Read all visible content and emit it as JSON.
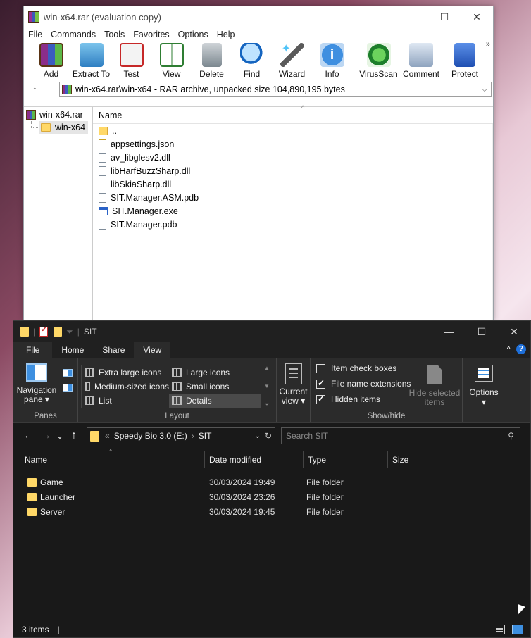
{
  "winrar": {
    "title": "win-x64.rar (evaluation copy)",
    "window_controls": {
      "minimize": "—",
      "maximize": "☐",
      "close": "✕"
    },
    "menu": [
      "File",
      "Commands",
      "Tools",
      "Favorites",
      "Options",
      "Help"
    ],
    "toolbar": [
      {
        "label": "Add",
        "icon": "add-archive-icon"
      },
      {
        "label": "Extract To",
        "icon": "extract-icon"
      },
      {
        "label": "Test",
        "icon": "test-icon"
      },
      {
        "label": "View",
        "icon": "view-book-icon"
      },
      {
        "label": "Delete",
        "icon": "trash-icon"
      },
      {
        "label": "Find",
        "icon": "magnifier-icon"
      },
      {
        "label": "Wizard",
        "icon": "magic-wand-icon"
      },
      {
        "label": "Info",
        "icon": "info-icon"
      },
      {
        "label": "VirusScan",
        "icon": "virus-scan-icon"
      },
      {
        "label": "Comment",
        "icon": "comment-icon"
      },
      {
        "label": "Protect",
        "icon": "shield-icon"
      }
    ],
    "more_glyph": "»",
    "up_glyph": "↑",
    "address": "win-x64.rar\\win-x64 - RAR archive, unpacked size 104,890,195 bytes",
    "address_dropdown": "⌵",
    "tree": {
      "root": "win-x64.rar",
      "child": "win-x64"
    },
    "column_name": "Name",
    "sort_glyph": "^",
    "files": [
      {
        "name": "..",
        "kind": "folder"
      },
      {
        "name": "appsettings.json",
        "kind": "json"
      },
      {
        "name": "av_libglesv2.dll",
        "kind": "dll"
      },
      {
        "name": "libHarfBuzzSharp.dll",
        "kind": "dll"
      },
      {
        "name": "libSkiaSharp.dll",
        "kind": "dll"
      },
      {
        "name": "SIT.Manager.ASM.pdb",
        "kind": "pdb"
      },
      {
        "name": "SIT.Manager.exe",
        "kind": "exe"
      },
      {
        "name": "SIT.Manager.pdb",
        "kind": "pdb"
      }
    ]
  },
  "explorer": {
    "title": "SIT",
    "title_separator": "|",
    "title_dropdown": "⏷",
    "window_controls": {
      "minimize": "—",
      "maximize": "☐",
      "close": "✕"
    },
    "tabs": [
      "File",
      "Home",
      "Share",
      "View"
    ],
    "active_tab": "View",
    "collapse_glyph": "^",
    "help_glyph": "?",
    "ribbon": {
      "panes": {
        "nav_pane_line1": "Navigation",
        "nav_pane_line2": "pane ▾",
        "group_label": "Panes"
      },
      "layout": {
        "items": [
          "Extra large icons",
          "Large icons",
          "Medium-sized icons",
          "Small icons",
          "List",
          "Details"
        ],
        "selected": "Details",
        "group_label": "Layout",
        "scroll_up": "▲",
        "scroll_down": "▼",
        "scroll_more": "⏷"
      },
      "current_view": {
        "line1": "Current",
        "line2": "view ▾"
      },
      "show_hide": {
        "item_check_boxes": {
          "label": "Item check boxes",
          "checked": false
        },
        "file_name_extensions": {
          "label": "File name extensions",
          "checked": true
        },
        "hidden_items": {
          "label": "Hidden items",
          "checked": true
        },
        "hide_selected_line1": "Hide selected",
        "hide_selected_line2": "items",
        "group_label": "Show/hide"
      },
      "options": {
        "label": "Options",
        "dropdown": "▾"
      }
    },
    "nav": {
      "back": "←",
      "forward": "→",
      "recent": "⌄",
      "up": "↑"
    },
    "address": {
      "prefix": "«",
      "drive": "Speedy Bio 3.0 (E:)",
      "separator": "›",
      "folder": "SIT",
      "dropdown": "⌄",
      "refresh": "↻"
    },
    "search_placeholder": "Search SIT",
    "search_glyph": "⚲",
    "columns": {
      "name": "Name",
      "date": "Date modified",
      "type": "Type",
      "size": "Size",
      "sort_glyph": "^"
    },
    "rows": [
      {
        "name": "Game",
        "date": "30/03/2024 19:49",
        "type": "File folder"
      },
      {
        "name": "Launcher",
        "date": "30/03/2024 23:26",
        "type": "File folder"
      },
      {
        "name": "Server",
        "date": "30/03/2024 19:45",
        "type": "File folder"
      }
    ],
    "status": {
      "count": "3 items",
      "separator": "|"
    }
  }
}
